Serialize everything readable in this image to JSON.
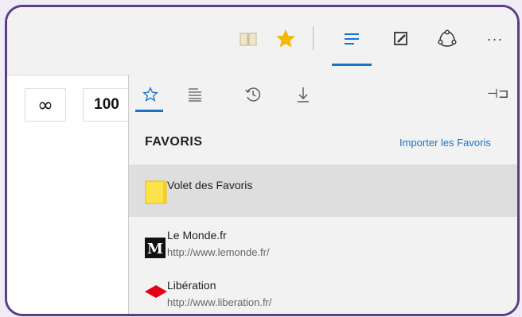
{
  "toolbar": {
    "icons": [
      "reading-view-icon",
      "favorites-star-icon",
      "hub-icon",
      "notes-icon",
      "share-icon",
      "more-icon"
    ],
    "more_label": "···",
    "accent_color": "#1a73c9",
    "star_color": "#f5b800"
  },
  "page": {
    "infinity_label": "∞",
    "hundred_label": "100"
  },
  "hub": {
    "tabs": [
      "favorites-tab",
      "reading-list-tab",
      "history-tab",
      "downloads-tab"
    ],
    "pin_label": "⊣⊐",
    "section_title": "FAVORIS",
    "import_link": "Importer les Favoris",
    "items": [
      {
        "name": "Volet des Favoris",
        "url": "",
        "icon": "folder-icon",
        "selected": true
      },
      {
        "name": "Le Monde.fr",
        "url": "http://www.lemonde.fr/",
        "icon": "le-monde-logo-icon",
        "selected": false
      },
      {
        "name": "Libération",
        "url": "http://www.liberation.fr/",
        "icon": "liberation-logo-icon",
        "selected": false
      }
    ]
  }
}
